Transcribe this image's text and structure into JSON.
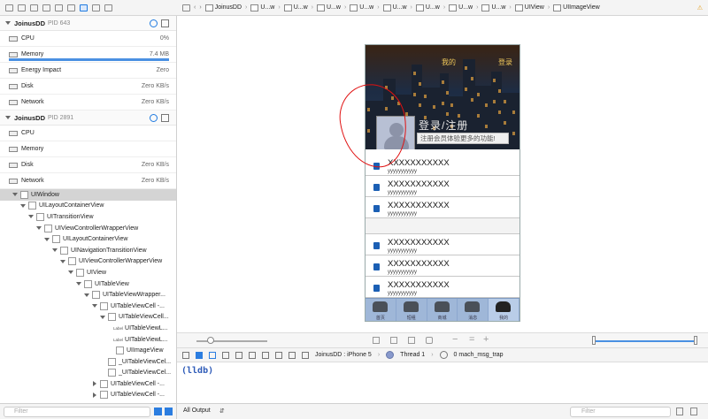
{
  "navigator": {
    "icons": [
      "folder-icon",
      "source-control-icon",
      "symbol-icon",
      "search-icon",
      "warning-icon",
      "test-icon",
      "debug-icon",
      "breakpoint-icon",
      "report-icon"
    ]
  },
  "processes": [
    {
      "name": "JoinusDD",
      "pid": "PID 643",
      "gauges": [
        {
          "label": "CPU",
          "value": "0%"
        },
        {
          "label": "Memory",
          "value": "7.4 MB",
          "bar_fraction": 1.0
        },
        {
          "label": "Energy Impact",
          "value": "Zero"
        },
        {
          "label": "Disk",
          "value": "Zero KB/s"
        },
        {
          "label": "Network",
          "value": "Zero KB/s"
        }
      ]
    },
    {
      "name": "JoinusDD",
      "pid": "PID 2891",
      "gauges": [
        {
          "label": "CPU",
          "value": ""
        },
        {
          "label": "Memory",
          "value": ""
        },
        {
          "label": "Disk",
          "value": "Zero KB/s"
        },
        {
          "label": "Network",
          "value": "Zero KB/s"
        }
      ]
    }
  ],
  "tree": [
    {
      "label": "UIWindow",
      "depth": 0,
      "open": true,
      "selected": true
    },
    {
      "label": "UILayoutContainerView",
      "depth": 1,
      "open": true
    },
    {
      "label": "UITransitionView",
      "depth": 2,
      "open": true
    },
    {
      "label": "UIViewControllerWrapperView",
      "depth": 3,
      "open": true
    },
    {
      "label": "UILayoutContainerView",
      "depth": 4,
      "open": true
    },
    {
      "label": "UINavigationTransitionView",
      "depth": 5,
      "open": true
    },
    {
      "label": "UIViewControllerWrapperView",
      "depth": 6,
      "open": true
    },
    {
      "label": "UIView",
      "depth": 7,
      "open": true
    },
    {
      "label": "UITableView",
      "depth": 8,
      "open": true
    },
    {
      "label": "UITableViewWrapper...",
      "depth": 9,
      "open": true
    },
    {
      "label": "UITableViewCell -...",
      "depth": 10,
      "open": true
    },
    {
      "label": "UITableViewCell...",
      "depth": 11,
      "open": true
    },
    {
      "label": "UITableViewL...",
      "depth": 12,
      "tag": "Label"
    },
    {
      "label": "UITableViewL...",
      "depth": 12,
      "tag": "Label"
    },
    {
      "label": "UIImageView",
      "depth": 12
    },
    {
      "label": "_UITableViewCel...",
      "depth": 11
    },
    {
      "label": "_UITableViewCel...",
      "depth": 11
    },
    {
      "label": "UITableViewCell -...",
      "depth": 10,
      "open": false
    },
    {
      "label": "UITableViewCell -...",
      "depth": 10,
      "open": false
    }
  ],
  "filter_placeholder": "Filter",
  "jumpbar": {
    "items": [
      "JoinusDD",
      "U...w",
      "U...w",
      "U...w",
      "U...w",
      "U...w",
      "U...w",
      "U...w",
      "U...w",
      "UIView",
      "UIImageView"
    ]
  },
  "phone": {
    "top_left": "",
    "top_mid": "我的",
    "top_right": "登录",
    "register_title": "登录/注册",
    "register_sub": "注册会员体验更多的功能!",
    "cells": [
      {
        "title": "XXXXXXXXXXX",
        "sub": "yyyyyyyyyyy"
      },
      {
        "title": "XXXXXXXXXXX",
        "sub": "yyyyyyyyyyy"
      },
      {
        "title": "XXXXXXXXXXX",
        "sub": "yyyyyyyyyyy"
      },
      {
        "title": "XXXXXXXXXXX",
        "sub": "yyyyyyyyyyy"
      },
      {
        "title": "XXXXXXXXXXX",
        "sub": "yyyyyyyyyyy"
      },
      {
        "title": "XXXXXXXXXXX",
        "sub": "yyyyyyyyyyy"
      }
    ],
    "tabs": [
      "首页",
      "短租",
      "商城",
      "消息",
      "我的"
    ]
  },
  "zoom_fraction": 0.2,
  "debugbar": {
    "device": "JoinusDD : iPhone 5",
    "thread": "Thread 1",
    "frame": "0 mach_msg_trap"
  },
  "console": {
    "prompt": "(lldb)"
  },
  "bottom": {
    "output_select": "All Output",
    "filter_placeholder": "Filter"
  },
  "colors": {
    "accent": "#1f7ae0",
    "annotation": "#e01010",
    "lldb": "#2e5bb8"
  }
}
